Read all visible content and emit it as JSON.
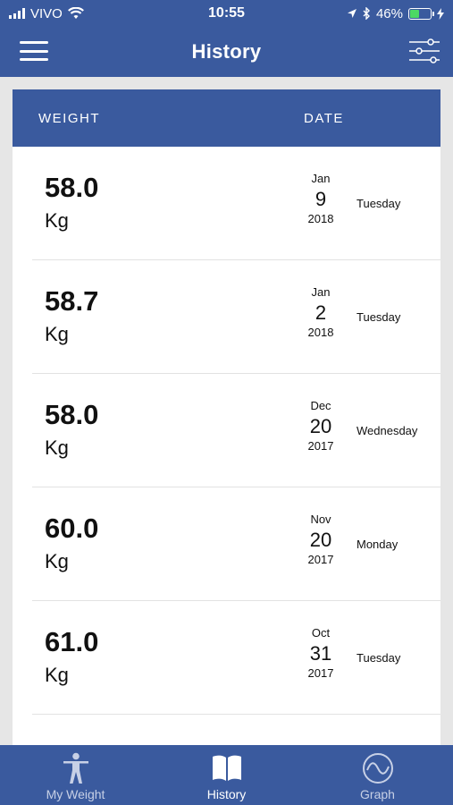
{
  "status_bar": {
    "carrier": "VIVO",
    "time": "10:55",
    "battery_percent": "46%",
    "battery_level": 0.46,
    "battery_color": "#4cd964"
  },
  "nav": {
    "title": "History",
    "left_icon": "hamburger-menu-icon",
    "right_icon": "sliders-filter-icon"
  },
  "table": {
    "headers": {
      "weight": "WEIGHT",
      "date": "DATE"
    },
    "rows": [
      {
        "weight": "58.0",
        "unit": "Kg",
        "month": "Jan",
        "day": "9",
        "year": "2018",
        "weekday": "Tuesday"
      },
      {
        "weight": "58.7",
        "unit": "Kg",
        "month": "Jan",
        "day": "2",
        "year": "2018",
        "weekday": "Tuesday"
      },
      {
        "weight": "58.0",
        "unit": "Kg",
        "month": "Dec",
        "day": "20",
        "year": "2017",
        "weekday": "Wednesday"
      },
      {
        "weight": "60.0",
        "unit": "Kg",
        "month": "Nov",
        "day": "20",
        "year": "2017",
        "weekday": "Monday"
      },
      {
        "weight": "61.0",
        "unit": "Kg",
        "month": "Oct",
        "day": "31",
        "year": "2017",
        "weekday": "Tuesday"
      }
    ]
  },
  "tabs": [
    {
      "label": "My Weight",
      "icon": "person-icon",
      "active": false
    },
    {
      "label": "History",
      "icon": "book-icon",
      "active": true
    },
    {
      "label": "Graph",
      "icon": "wave-graph-icon",
      "active": false
    }
  ],
  "colors": {
    "primary": "#3a5a9e",
    "background": "#e6e6e6"
  }
}
